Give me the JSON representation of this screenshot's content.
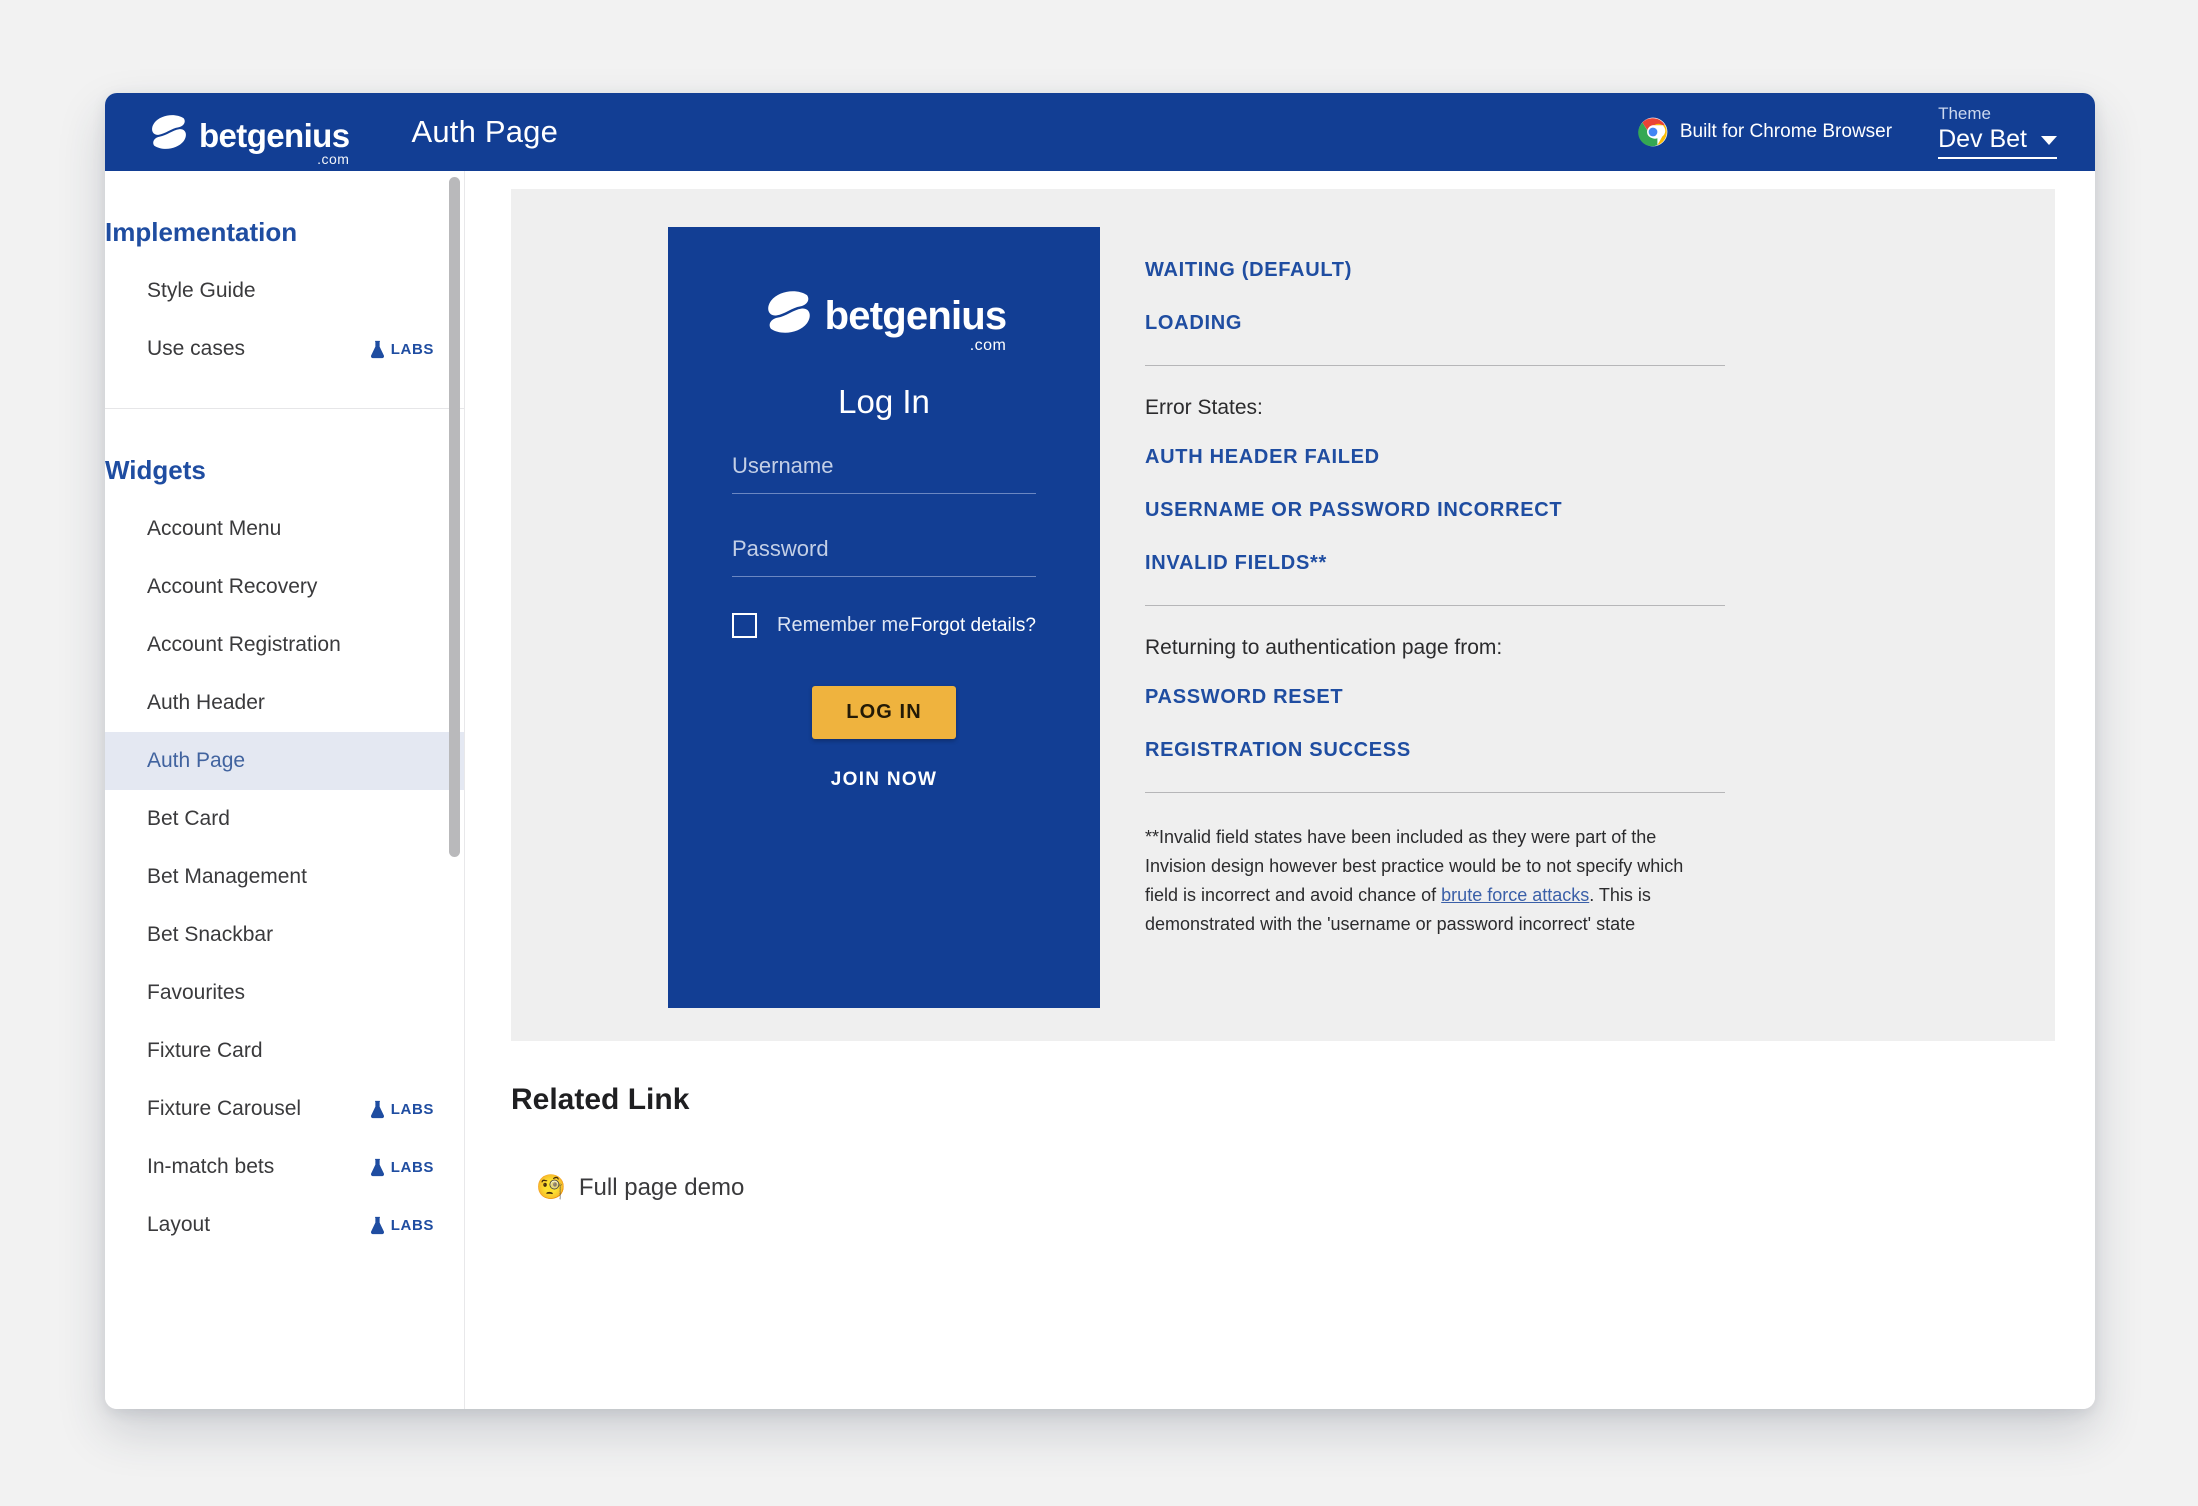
{
  "header": {
    "brand_name": "betgenius",
    "brand_suffix": ".com",
    "page_title": "Auth Page",
    "chrome_note": "Built for Chrome Browser",
    "theme_label": "Theme",
    "theme_value": "Dev Bet"
  },
  "sidebar": {
    "sections": [
      {
        "heading": "Implementation",
        "items": [
          {
            "label": "Style Guide",
            "badge": "",
            "active": false
          },
          {
            "label": "Use cases",
            "badge": "LABS",
            "active": false
          }
        ]
      },
      {
        "heading": "Widgets",
        "items": [
          {
            "label": "Account Menu",
            "badge": "",
            "active": false
          },
          {
            "label": "Account Recovery",
            "badge": "",
            "active": false
          },
          {
            "label": "Account Registration",
            "badge": "",
            "active": false
          },
          {
            "label": "Auth Header",
            "badge": "",
            "active": false
          },
          {
            "label": "Auth Page",
            "badge": "",
            "active": true
          },
          {
            "label": "Bet Card",
            "badge": "",
            "active": false
          },
          {
            "label": "Bet Management",
            "badge": "",
            "active": false
          },
          {
            "label": "Bet Snackbar",
            "badge": "",
            "active": false
          },
          {
            "label": "Favourites",
            "badge": "",
            "active": false
          },
          {
            "label": "Fixture Card",
            "badge": "",
            "active": false
          },
          {
            "label": "Fixture Carousel",
            "badge": "LABS",
            "active": false
          },
          {
            "label": "In-match bets",
            "badge": "LABS",
            "active": false
          },
          {
            "label": "Layout",
            "badge": "LABS",
            "active": false
          }
        ]
      }
    ]
  },
  "login_card": {
    "brand_name": "betgenius",
    "brand_suffix": ".com",
    "title": "Log In",
    "username_placeholder": "Username",
    "username_value": "",
    "password_placeholder": "Password",
    "password_value": "",
    "remember_label": "Remember me",
    "forgot_label": "Forgot details?",
    "login_button": "LOG IN",
    "join_button": "JOIN NOW"
  },
  "states_panel": {
    "primary_states": [
      "WAITING (DEFAULT)",
      "LOADING"
    ],
    "error_heading": "Error States:",
    "error_states": [
      "AUTH HEADER FAILED",
      "USERNAME OR PASSWORD INCORRECT",
      "INVALID FIELDS**"
    ],
    "returning_heading": "Returning to authentication page from:",
    "returning_states": [
      "PASSWORD RESET",
      "REGISTRATION SUCCESS"
    ],
    "footnote_part1": "**Invalid field states have been included as they were part of the Invision design however best practice would be to not specify which field is incorrect and avoid chance of ",
    "footnote_link": "brute force attacks",
    "footnote_part2": ". This is demonstrated with the 'username or password incorrect' state"
  },
  "related": {
    "title": "Related Link",
    "emoji": "🧐",
    "label": "Full page demo"
  },
  "colors": {
    "brand_blue": "#123E94",
    "accent_blue": "#1F4DA1",
    "amber": "#EFB33E",
    "active_item_bg": "#E4E8F2",
    "stage_bg": "#efefef"
  }
}
